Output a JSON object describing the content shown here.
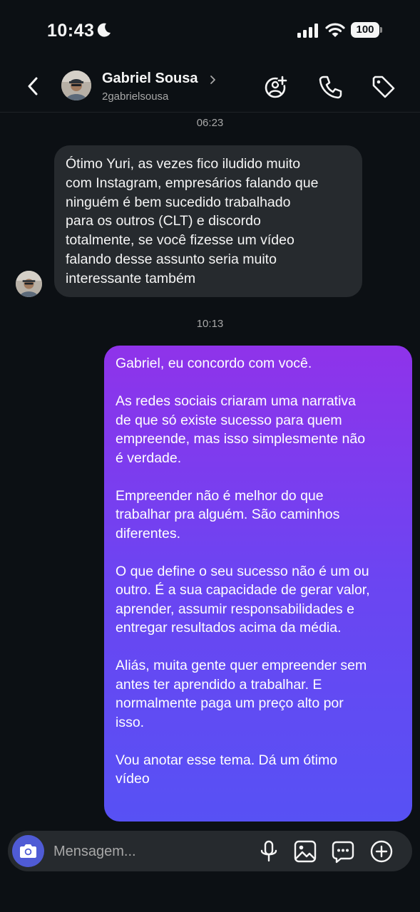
{
  "status_bar": {
    "time": "10:43",
    "battery": "100"
  },
  "header": {
    "contact_name": "Gabriel Sousa",
    "username": "2gabrielsousa"
  },
  "messages": [
    {
      "timestamp": "06:23",
      "direction": "incoming",
      "text": "Ótimo Yuri, as vezes fico iludido muito\ncom Instagram, empresários falando que\nninguém é bem sucedido trabalhado\npara os outros (CLT) e discordo\ntotalmente, se você fizesse um vídeo\nfalando desse assunto seria muito\ninteressante também"
    },
    {
      "timestamp": "10:13",
      "direction": "outgoing",
      "text": "Gabriel, eu concordo com você.\n\nAs redes sociais criaram uma narrativa\nde que só existe sucesso para quem\nempreende, mas isso simplesmente não\né verdade.\n\nEmpreender não é melhor do que\ntrabalhar pra alguém. São caminhos\ndiferentes.\n\nO que define o seu sucesso não é um ou\noutro. É a sua capacidade de gerar valor,\naprender, assumir responsabilidades e\nentregar resultados acima da média.\n\nAliás, muita gente quer empreender sem\nantes ter aprendido a trabalhar. E\nnormalmente paga um preço alto por\nisso.\n\nVou anotar esse tema. Dá um ótimo\nvídeo"
    }
  ],
  "composer": {
    "placeholder": "Mensagem..."
  },
  "icons": {
    "status": [
      "moon-icon",
      "signal-icon",
      "wifi-icon",
      "battery-icon"
    ],
    "header": [
      "back-arrow-icon",
      "add-person-icon",
      "phone-icon",
      "tag-icon"
    ],
    "composer": [
      "camera-icon",
      "microphone-icon",
      "gallery-icon",
      "sticker-icon",
      "add-icon"
    ]
  },
  "colors": {
    "background": "#0c1014",
    "incoming_bubble": "#262a2e",
    "outgoing_gradient_top": "#8f33ea",
    "outgoing_gradient_bottom": "#5751f4",
    "camera_button": "#4f5bd5",
    "secondary_text": "#a8a8a8"
  }
}
